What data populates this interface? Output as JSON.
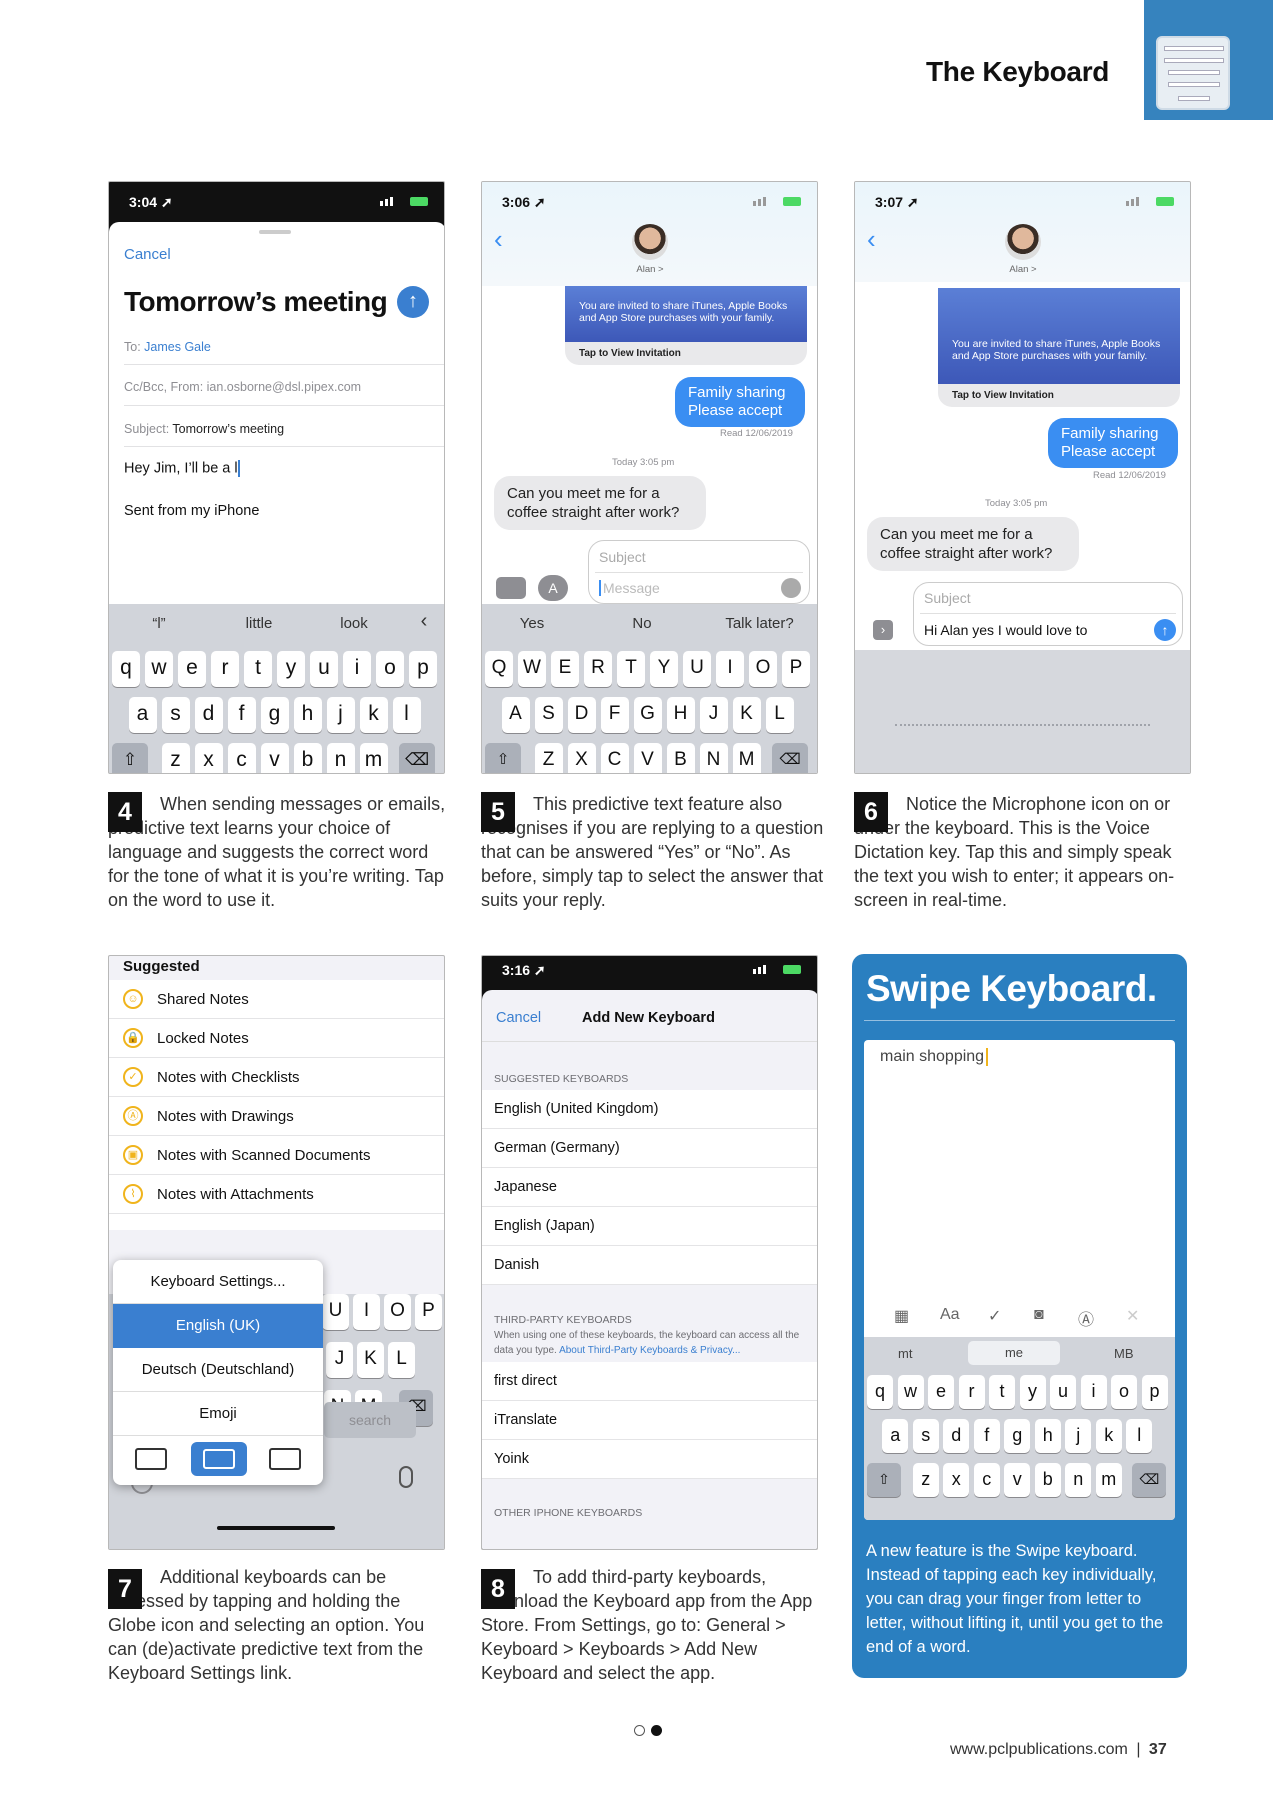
{
  "header": {
    "title": "The Keyboard"
  },
  "shot4": {
    "time": "3:04",
    "cancel": "Cancel",
    "subject_title": "Tomorrow’s meeting",
    "to_label": "To:",
    "to_value": "James Gale",
    "ccbcc": "Cc/Bcc, From:",
    "from_email": "ian.osborne@dsl.pipex.com",
    "subject_label": "Subject:",
    "subject_value": "Tomorrow’s meeting",
    "body": "Hey Jim, I’ll be a l",
    "signature": "Sent from my iPhone",
    "suggestions": [
      "“l”",
      "little",
      "look"
    ],
    "row1": [
      "q",
      "w",
      "e",
      "r",
      "t",
      "y",
      "u",
      "i",
      "o",
      "p"
    ],
    "row2": [
      "a",
      "s",
      "d",
      "f",
      "g",
      "h",
      "j",
      "k",
      "l"
    ],
    "row3": [
      "z",
      "x",
      "c",
      "v",
      "b",
      "n",
      "m"
    ]
  },
  "shot5": {
    "time": "3:06",
    "contact": "Alan >",
    "invite_text": "You are invited to share iTunes, Apple Books and App Store purchases with your family.",
    "invite_foot": "Tap to View Invitation",
    "bubble_out": "Family sharing Please accept",
    "read": "Read 12/06/2019",
    "today": "Today 3:05 pm",
    "bubble_in": "Can you meet me for a coffee straight after work?",
    "subject_ph": "Subject",
    "message_ph": "Message",
    "suggestions": [
      "Yes",
      "No",
      "Talk later?"
    ],
    "row1": [
      "Q",
      "W",
      "E",
      "R",
      "T",
      "Y",
      "U",
      "I",
      "O",
      "P"
    ],
    "row2": [
      "A",
      "S",
      "D",
      "F",
      "G",
      "H",
      "J",
      "K",
      "L"
    ],
    "row3": [
      "Z",
      "X",
      "C",
      "V",
      "B",
      "N",
      "M"
    ]
  },
  "shot6": {
    "time": "3:07",
    "contact": "Alan >",
    "invite_text": "You are invited to share iTunes, Apple Books and App Store purchases with your family.",
    "invite_foot": "Tap to View Invitation",
    "bubble_out": "Family sharing Please accept",
    "read": "Read 12/06/2019",
    "today": "Today 3:05 pm",
    "bubble_in": "Can you meet me for a coffee straight after work?",
    "subject_ph": "Subject",
    "message": "Hi Alan yes I would love to"
  },
  "captions": {
    "c4": {
      "num": "4",
      "text": "When sending messages or emails, predictive text learns your choice of language and suggests the correct word for the tone of what it is you’re writing. Tap on the word to use it."
    },
    "c5": {
      "num": "5",
      "text": "This predictive text feature also recognises if you are replying to a question that can be answered “Yes” or “No”. As before, simply tap to select the answer that suits your reply."
    },
    "c6": {
      "num": "6",
      "text": "Notice the Microphone icon on or under the keyboard. This is the Voice Dictation key. Tap this and simply speak the text you wish to enter; it appears on-screen in real-time."
    },
    "c7": {
      "num": "7",
      "text": "Additional keyboards can be accessed by tapping and holding the Globe icon and selecting an option. You can (de)activate predictive text from the Keyboard Settings link."
    },
    "c8": {
      "num": "8",
      "text": "To add third-party keyboards, download the Keyboard app from the App Store. From Settings, go to: General > Keyboard > Keyboards > Add New Keyboard and select the app."
    }
  },
  "shot7": {
    "header": "Suggested",
    "items": [
      "Shared Notes",
      "Locked Notes",
      "Notes with Checklists",
      "Notes with Drawings",
      "Notes with Scanned Documents",
      "Notes with Attachments"
    ],
    "menu": [
      "Keyboard Settings...",
      "English (UK)",
      "Deutsch (Deutschland)",
      "Emoji"
    ],
    "keys_r1": [
      "U",
      "I",
      "O",
      "P"
    ],
    "keys_r2": [
      "J",
      "K",
      "L"
    ],
    "keys_r3": [
      "N",
      "M"
    ],
    "search": "search"
  },
  "shot8": {
    "time": "3:16",
    "cancel": "Cancel",
    "title": "Add New Keyboard",
    "suggested_header": "SUGGESTED KEYBOARDS",
    "suggested": [
      "English (United Kingdom)",
      "German (Germany)",
      "Japanese",
      "English (Japan)",
      "Danish"
    ],
    "third_header": "THIRD-PARTY KEYBOARDS",
    "third_note": "When using one of these keyboards, the keyboard can access all the data you type.",
    "third_link": "About Third-Party Keyboards & Privacy...",
    "third": [
      "first direct",
      "iTranslate",
      "Yoink"
    ],
    "other_header": "OTHER IPHONE KEYBOARDS"
  },
  "swipe": {
    "title": "Swipe Keyboard.",
    "note_text": "main shopping",
    "suggestions": [
      "mt",
      "me",
      "MB"
    ],
    "row1": [
      "q",
      "w",
      "e",
      "r",
      "t",
      "y",
      "u",
      "i",
      "o",
      "p"
    ],
    "row2": [
      "a",
      "s",
      "d",
      "f",
      "g",
      "h",
      "j",
      "k",
      "l"
    ],
    "row3": [
      "z",
      "x",
      "c",
      "v",
      "b",
      "n",
      "m"
    ],
    "text": "A new feature is the Swipe keyboard. Instead of tapping each key individually, you can drag your finger from letter to letter, without lifting it, until you get to the end of a word."
  },
  "footer": {
    "url": "www.pclpublications.com",
    "sep": "|",
    "page": "37"
  },
  "colors": {
    "accent": "#2a7fc0",
    "ios_blue": "#3a8ef2"
  }
}
